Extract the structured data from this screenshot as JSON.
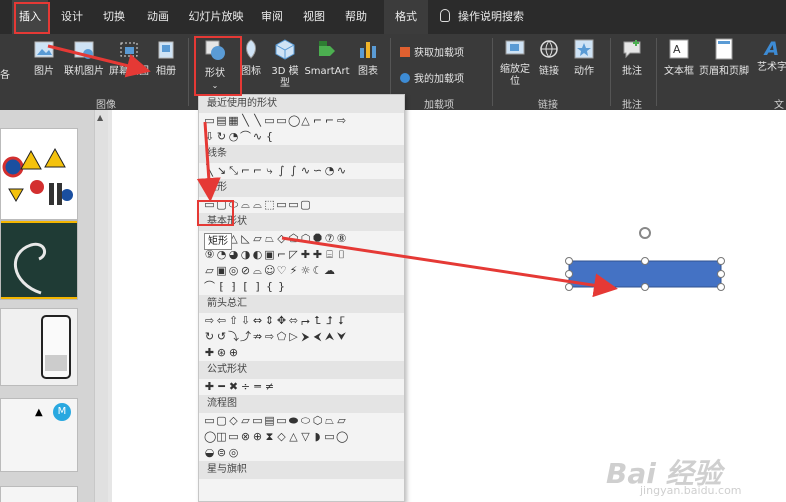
{
  "tabs": [
    {
      "label": "插入",
      "active": true
    },
    {
      "label": "设计"
    },
    {
      "label": "切换"
    },
    {
      "label": "动画"
    },
    {
      "label": "幻灯片放映"
    },
    {
      "label": "审阅"
    },
    {
      "label": "视图"
    },
    {
      "label": "帮助"
    },
    {
      "label": "格式"
    }
  ],
  "search_label": "操作说明搜索",
  "ribbon": {
    "left_cut": "各",
    "picture": "图片",
    "online_picture": "联机图片",
    "screenshot": "屏幕截图",
    "album": "相册",
    "shapes": "形状",
    "icons": "图标",
    "model3d": "3D 模型",
    "smartart": "SmartArt",
    "chart": "图表",
    "get_addins": "获取加载项",
    "my_addins": "我的加载项",
    "zoom": "缩放定位",
    "link": "链接",
    "action": "动作",
    "comment": "批注",
    "textbox": "文本框",
    "header_footer": "页眉和页脚",
    "wordart": "艺术字",
    "groups": {
      "images": "图像",
      "addins": "加载项",
      "links": "链接",
      "comments": "批注",
      "text": "文"
    }
  },
  "dropdown": {
    "recent": "最近使用的形状",
    "lines": "线条",
    "rect": "矩形",
    "basic": "基本形状",
    "arrows": "箭头总汇",
    "equation": "公式形状",
    "flowchart": "流程图",
    "stars": "星与旗帜"
  },
  "tooltip": "矩形",
  "watermark": "Bai 经验",
  "watermark_sub": "jingyan.baidu.com",
  "colors": {
    "accent_red": "#e53935",
    "shape_fill": "#4472c4",
    "tabbar_bg": "#2b2b2b",
    "ribbon_bg": "#3a3a3a"
  }
}
